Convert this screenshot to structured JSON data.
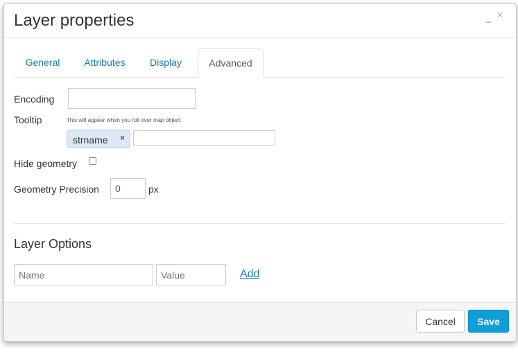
{
  "dialog": {
    "title": "Layer properties",
    "minimize_glyph": "‗",
    "close_glyph": "×"
  },
  "tabs": [
    {
      "label": "General"
    },
    {
      "label": "Attributes"
    },
    {
      "label": "Display"
    },
    {
      "label": "Advanced",
      "active": true
    }
  ],
  "form": {
    "encoding_label": "Encoding",
    "encoding_value": "",
    "tooltip_label": "Tooltip",
    "tooltip_help": "This will appear when you roll over map object",
    "tooltip_tag": "strname",
    "tooltip_tag_remove": "×",
    "tooltip_input_value": "",
    "hide_geometry_label": "Hide geometry",
    "hide_geometry_checked": false,
    "precision_label": "Geometry Precision",
    "precision_value": "0",
    "precision_unit": "px"
  },
  "layer_options": {
    "title": "Layer Options",
    "name_placeholder": "Name",
    "value_placeholder": "Value",
    "add_label": "Add"
  },
  "footer": {
    "cancel_label": "Cancel",
    "save_label": "Save"
  },
  "colors": {
    "link": "#1a7bb0",
    "primary": "#0e9ed8",
    "tag_bg": "#dce9f5"
  }
}
